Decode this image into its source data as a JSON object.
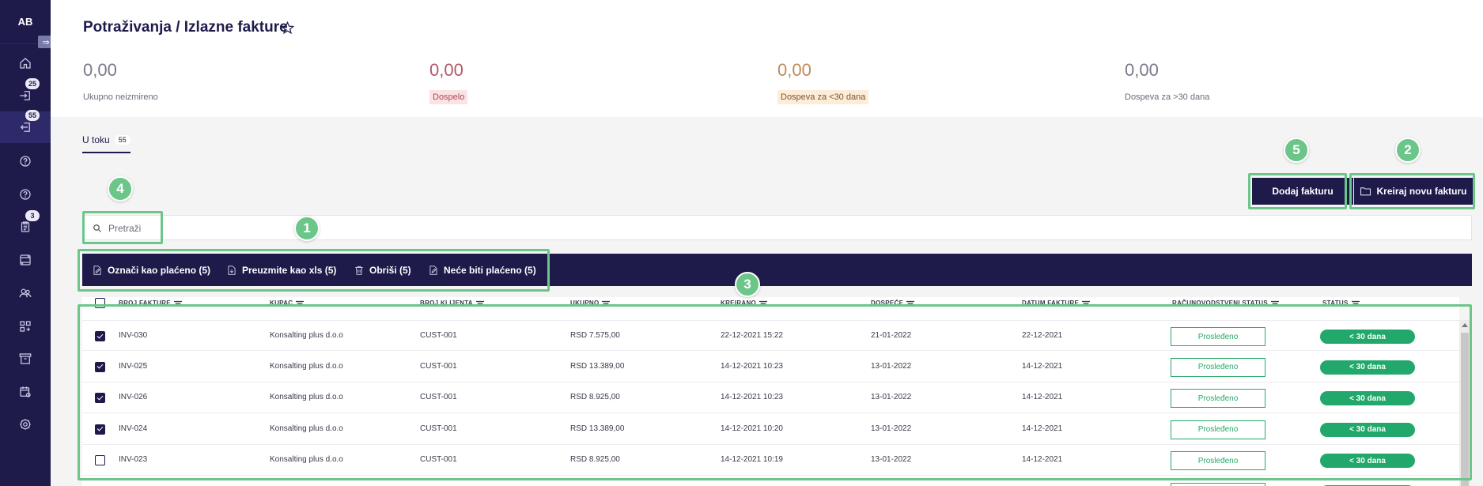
{
  "sidebar": {
    "avatar": "AB",
    "toggle_icon": "expand-icon",
    "items": [
      {
        "icon": "home-icon",
        "badge": ""
      },
      {
        "icon": "login-icon",
        "badge": "25"
      },
      {
        "icon": "logout-icon",
        "badge": "55",
        "active": true
      },
      {
        "icon": "help-icon",
        "badge": ""
      },
      {
        "icon": "help-icon",
        "badge": ""
      },
      {
        "icon": "clipboard-icon",
        "badge": "3"
      },
      {
        "icon": "transfer-icon",
        "badge": ""
      },
      {
        "icon": "users-icon",
        "badge": ""
      },
      {
        "icon": "apps-add-icon",
        "badge": ""
      },
      {
        "icon": "archive-icon",
        "badge": ""
      },
      {
        "icon": "calendar-settings-icon",
        "badge": ""
      },
      {
        "icon": "gear-icon",
        "badge": ""
      }
    ]
  },
  "header": {
    "title": "Potraživanja / Izlazne fakture",
    "stats": [
      {
        "value": "0,00",
        "label": "Ukupno neizmireno"
      },
      {
        "value": "0,00",
        "label": "Dospelo"
      },
      {
        "value": "0,00",
        "label": "Dospeva za <30 dana"
      },
      {
        "value": "0,00",
        "label": "Dospeva za >30 dana"
      }
    ]
  },
  "tabs": [
    {
      "label": "U toku",
      "count": "55"
    }
  ],
  "buttons": {
    "add_invoice": "Dodaj fakturu",
    "create_invoice": "Kreiraj novu fakturu"
  },
  "search": {
    "placeholder": "Pretraži"
  },
  "actions": [
    {
      "label": "Označi kao plaćeno (5)",
      "icon": "edit-doc-icon"
    },
    {
      "label": "Preuzmite kao xls (5)",
      "icon": "download-doc-icon"
    },
    {
      "label": "Obriši (5)",
      "icon": "trash-icon"
    },
    {
      "label": "Neće biti plaćeno (5)",
      "icon": "edit-doc-icon"
    }
  ],
  "markers": [
    "1",
    "2",
    "3",
    "4",
    "5"
  ],
  "table": {
    "headers": [
      "BROJ FAKTURE",
      "KUPAC",
      "BROJ KLIJENTA",
      "UKUPNO",
      "KREIRANO",
      "DOSPEĆE",
      "DATUM FAKTURE",
      "RAČUNOVODSTVENI STATUS",
      "STATUS"
    ],
    "rows": [
      {
        "checked": true,
        "invoice": "INV-030",
        "customer": "Konsalting plus d.o.o",
        "client": "CUST-001",
        "total": "RSD 7.575,00",
        "created": "22-12-2021 15:22",
        "due": "21-01-2022",
        "date": "22-12-2021",
        "acc_status": "Prosleđeno",
        "status": "< 30 dana"
      },
      {
        "checked": true,
        "invoice": "INV-025",
        "customer": "Konsalting plus d.o.o",
        "client": "CUST-001",
        "total": "RSD 13.389,00",
        "created": "14-12-2021 10:23",
        "due": "13-01-2022",
        "date": "14-12-2021",
        "acc_status": "Prosleđeno",
        "status": "< 30 dana"
      },
      {
        "checked": true,
        "invoice": "INV-026",
        "customer": "Konsalting plus d.o.o",
        "client": "CUST-001",
        "total": "RSD 8.925,00",
        "created": "14-12-2021 10:23",
        "due": "13-01-2022",
        "date": "14-12-2021",
        "acc_status": "Prosleđeno",
        "status": "< 30 dana"
      },
      {
        "checked": true,
        "invoice": "INV-024",
        "customer": "Konsalting plus d.o.o",
        "client": "CUST-001",
        "total": "RSD 13.389,00",
        "created": "14-12-2021 10:20",
        "due": "13-01-2022",
        "date": "14-12-2021",
        "acc_status": "Prosleđeno",
        "status": "< 30 dana"
      },
      {
        "checked": false,
        "invoice": "INV-023",
        "customer": "Konsalting plus d.o.o",
        "client": "CUST-001",
        "total": "RSD 8.925,00",
        "created": "14-12-2021 10:19",
        "due": "13-01-2022",
        "date": "14-12-2021",
        "acc_status": "Prosleđeno",
        "status": "< 30 dana"
      },
      {
        "checked": false,
        "invoice": "",
        "customer": "",
        "client": "",
        "total": "",
        "created": "",
        "due": "",
        "date": "",
        "acc_status": "",
        "status": ""
      }
    ]
  },
  "colors": {
    "brand_navy": "#1e1b4b",
    "callout_green": "#6cc68a",
    "status_green": "#21a86a"
  }
}
